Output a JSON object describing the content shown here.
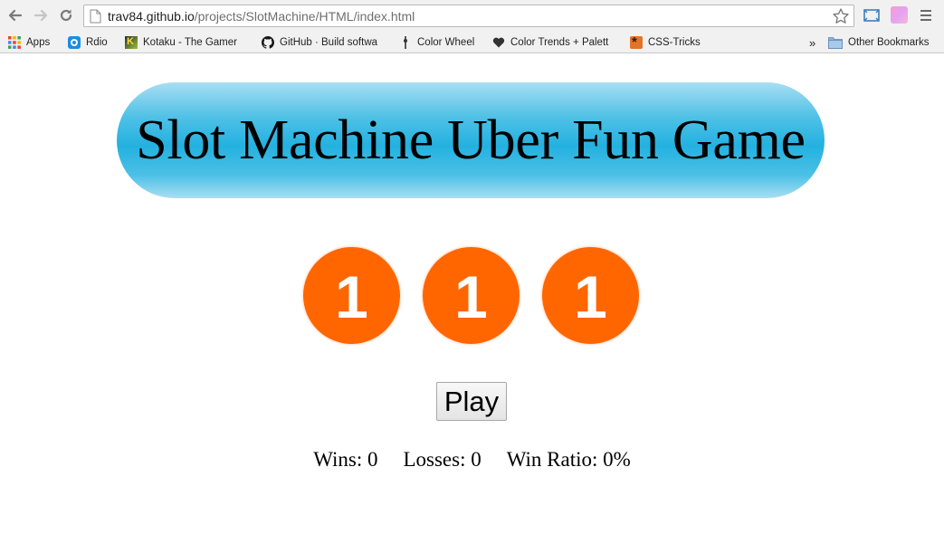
{
  "browser": {
    "url_host": "trav84.github.io",
    "url_path": "/projects/SlotMachine/HTML/index.html",
    "bookmarks": [
      {
        "label": "Apps",
        "icon": "apps-grid-icon"
      },
      {
        "label": "Rdio",
        "icon": "rdio-icon"
      },
      {
        "label": "Kotaku - The Gamer",
        "icon": "kotaku-icon"
      },
      {
        "label": "GitHub · Build softwa",
        "icon": "github-icon"
      },
      {
        "label": "Color Wheel",
        "icon": "color-wheel-icon"
      },
      {
        "label": "Color Trends + Palett",
        "icon": "color-trends-icon"
      },
      {
        "label": "CSS-Tricks",
        "icon": "css-tricks-icon"
      }
    ],
    "overflow_label": "»",
    "other_bookmarks": "Other Bookmarks"
  },
  "page": {
    "title": "Slot Machine Uber Fun Game",
    "reels": [
      "1",
      "1",
      "1"
    ],
    "reel_color": "#ff6600",
    "banner_color": "#23b1e0",
    "play_label": "Play",
    "stats": {
      "wins": "Wins: 0",
      "losses": "Losses: 0",
      "ratio": "Win Ratio: 0%"
    }
  }
}
